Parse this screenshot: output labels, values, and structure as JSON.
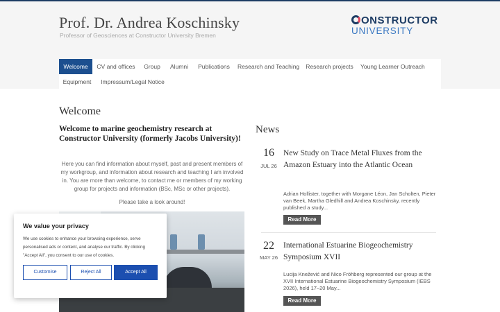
{
  "site": {
    "title": "Prof. Dr. Andrea Koschinsky",
    "subtitle": "Professor of Geosciences at Constructor University Bremen",
    "logo_line1": "ONSTRUCTOR",
    "logo_line2": "UNIVERSITY",
    "brand_colors": {
      "navy": "#1c3b63",
      "blue": "#3a78c2",
      "accent": "#e2445c"
    }
  },
  "nav": {
    "items": [
      {
        "label": "Welcome",
        "active": true
      },
      {
        "label": "CV and offices"
      },
      {
        "label": "Group"
      },
      {
        "label": "Alumni"
      },
      {
        "label": "Publications"
      },
      {
        "label": "Research and Teaching"
      },
      {
        "label": "Research projects"
      },
      {
        "label": "Young Learner Outreach"
      },
      {
        "label": "Equipment"
      },
      {
        "label": "Impressum/Legal Notice"
      }
    ]
  },
  "main": {
    "heading": "Welcome",
    "intro_heading": "Welcome to marine geochemistry research at Constructor University (formerly Jacobs University)!",
    "intro_text": "Here you can find information about myself, past and present members of my workgroup, and information about research and teaching I am involved in. You are more than welcome, to contact me or members of my working group for projects and information (BSc, MSc or other projects).",
    "intro_look": "Please take a look around!"
  },
  "news": {
    "heading": "News",
    "items": [
      {
        "day": "16",
        "month": "JUL 26",
        "title": "New Study on Trace Metal Fluxes from the Amazon Estuary into the Atlantic Ocean",
        "excerpt": "Adrian Hollister, together with Morgane Léon, Jan Scholten, Pieter van Beek, Martha Gledhill and Andrea Koschinsky, recently published a study...",
        "button": "Read More"
      },
      {
        "day": "22",
        "month": "MAY 26",
        "title": "International Estuarine Biogeochemistry Symposium XVII",
        "excerpt": "Lucija Knežević and Nico Fröhberg represented our group at the XVII International Estuarine Biogeochemistry Symposium (IEBS 2026), held 17–20 May...",
        "button": "Read More"
      }
    ]
  },
  "cookie": {
    "title": "We value your privacy",
    "text": "We use cookies to enhance your browsing experience, serve personalised ads or content, and analyse our traffic. By clicking \"Accept All\", you consent to our use of cookies.",
    "customise": "Customise",
    "reject": "Reject All",
    "accept": "Accept All"
  }
}
